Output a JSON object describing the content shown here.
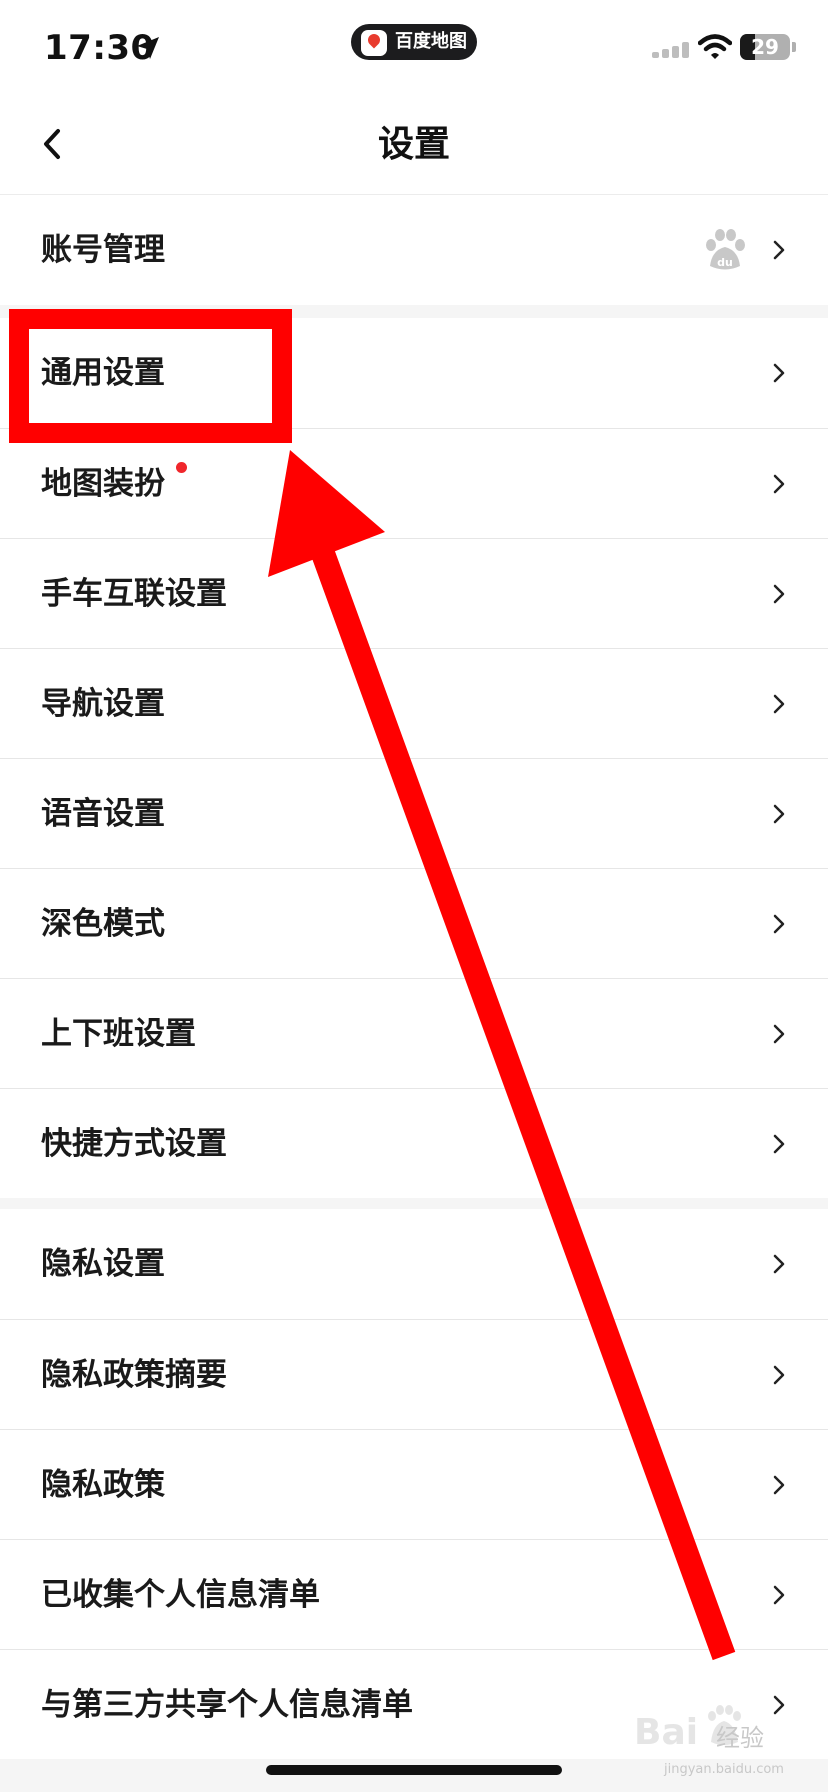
{
  "status_bar": {
    "time": "17:30",
    "app_pill": "百度地图",
    "battery": "29",
    "battery_level": 0.29
  },
  "nav": {
    "title": "设置"
  },
  "groups": [
    {
      "items": [
        {
          "label": "账号管理"
        }
      ]
    },
    {
      "items": [
        {
          "label": "通用设置"
        },
        {
          "label": "地图装扮"
        },
        {
          "label": "手车互联设置"
        },
        {
          "label": "导航设置"
        },
        {
          "label": "语音设置"
        },
        {
          "label": "深色模式"
        },
        {
          "label": "上下班设置"
        },
        {
          "label": "快捷方式设置"
        }
      ]
    },
    {
      "items": [
        {
          "label": "隐私设置"
        },
        {
          "label": "隐私政策摘要"
        },
        {
          "label": "隐私政策"
        },
        {
          "label": "已收集个人信息清单"
        },
        {
          "label": "与第三方共享个人信息清单"
        }
      ]
    }
  ],
  "watermark": {
    "text": "经验",
    "sub": "jingyan.baidu.com"
  },
  "colors": {
    "annotation": "#ff0000",
    "badge_dot": "#f0262b",
    "text": "#1a1a1a",
    "separator": "#f5f5f5"
  },
  "icons": [
    "location-arrow-icon",
    "signal-icon",
    "wifi-icon",
    "battery-icon",
    "back-chevron-icon",
    "baidu-paw-icon",
    "chevron-right-icon"
  ]
}
